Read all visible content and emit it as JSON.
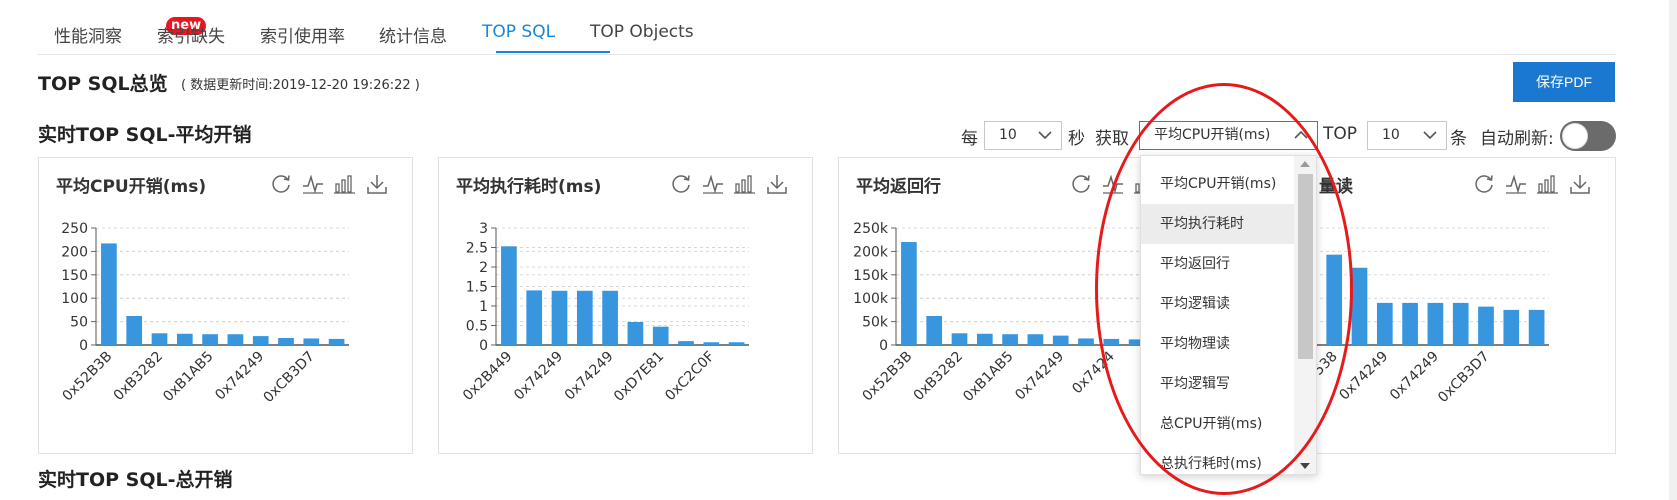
{
  "tabs": [
    {
      "label": "性能洞察",
      "badge": "new"
    },
    {
      "label": "索引缺失"
    },
    {
      "label": "索引使用率"
    },
    {
      "label": "统计信息"
    },
    {
      "label": "TOP SQL",
      "active": true
    },
    {
      "label": "TOP Objects"
    }
  ],
  "overview": {
    "title": "TOP SQL总览",
    "update_time": "( 数据更新时间:2019-12-20 19:26:22 )",
    "save_pdf": "保存PDF"
  },
  "section_realtime_avg": "实时TOP SQL-平均开销",
  "section_realtime_total": "实时TOP SQL-总开销",
  "controls": {
    "every": "每",
    "interval_value": "10",
    "seconds": "秒",
    "fetch": "获取",
    "metric_value": "平均CPU开销(ms)",
    "top": "TOP",
    "top_value": "10",
    "items": "条",
    "auto_refresh": "自动刷新:",
    "auto_refresh_on": false
  },
  "dropdown": {
    "options": [
      "平均CPU开销(ms)",
      "平均执行耗时",
      "平均返回行",
      "平均逻辑读",
      "平均物理读",
      "平均逻辑写",
      "总CPU开销(ms)",
      "总执行耗时(ms)"
    ],
    "hovered_index": 1
  },
  "tool_icons": [
    "refresh-icon",
    "line-chart-icon",
    "bar-chart-icon",
    "download-icon"
  ],
  "colors": {
    "accent": "#1a86d8",
    "bar": "#3796de",
    "badge": "#e8171f",
    "annotation": "#e51b1b"
  },
  "chart_data": [
    {
      "type": "bar",
      "title": "平均CPU开销(ms)",
      "categories": [
        "0x52B3B",
        "",
        "0xB3282",
        "",
        "0xB1AB5",
        "",
        "0x74249",
        "",
        "0xCB3D7",
        ""
      ],
      "values": [
        217,
        62,
        25,
        24,
        23,
        23,
        19,
        15,
        14,
        13
      ],
      "yticks": [
        "0",
        "50",
        "100",
        "150",
        "200",
        "250"
      ],
      "ylim": [
        0,
        250
      ]
    },
    {
      "type": "bar",
      "title": "平均执行耗时(ms)",
      "categories": [
        "0x2B449",
        "",
        "0x74249",
        "",
        "0x74249",
        "",
        "0xD7E81",
        "",
        "0xC2C0F",
        ""
      ],
      "values": [
        2.53,
        1.4,
        1.39,
        1.39,
        1.39,
        0.59,
        0.47,
        0.1,
        0.07,
        0.07
      ],
      "yticks": [
        "0",
        "0.5",
        "1",
        "1.5",
        "2",
        "2.5",
        "3"
      ],
      "ylim": [
        0,
        3
      ]
    },
    {
      "type": "bar",
      "title": "平均返回行",
      "categories": [
        "0x52B3B",
        "",
        "0xB3282",
        "",
        "0xB1AB5",
        "",
        "0x74249",
        "",
        "0x7424",
        ""
      ],
      "values": [
        220000,
        62000,
        25000,
        24000,
        23000,
        23000,
        20000,
        14000,
        13000,
        12000
      ],
      "yticks": [
        "0",
        "50k",
        "100k",
        "150k",
        "200k",
        "250k"
      ],
      "ylim": [
        0,
        250000
      ]
    },
    {
      "type": "bar",
      "title": "量读",
      "categories": [
        "",
        "0xA7538",
        "",
        "0x74249",
        "",
        "0x74249",
        "",
        "0xCB3D7",
        ""
      ],
      "values": [
        230,
        193,
        165,
        90,
        90,
        90,
        90,
        82,
        75,
        75
      ],
      "yticks": [],
      "ylim": [
        0,
        250
      ]
    }
  ]
}
